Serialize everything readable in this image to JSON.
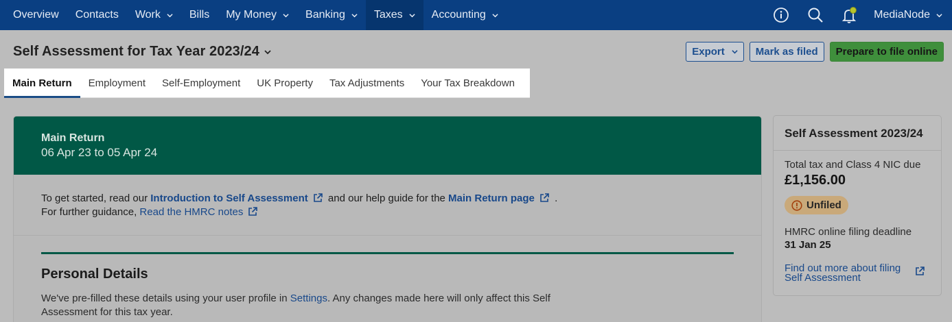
{
  "nav": {
    "items": [
      {
        "label": "Overview",
        "dropdown": false
      },
      {
        "label": "Contacts",
        "dropdown": false
      },
      {
        "label": "Work",
        "dropdown": true
      },
      {
        "label": "Bills",
        "dropdown": false
      },
      {
        "label": "My Money",
        "dropdown": true
      },
      {
        "label": "Banking",
        "dropdown": true
      },
      {
        "label": "Taxes",
        "dropdown": true,
        "active": true
      },
      {
        "label": "Accounting",
        "dropdown": true
      }
    ],
    "user": "MediaNode",
    "icons": [
      "info-icon",
      "search-icon",
      "bell-icon"
    ]
  },
  "header": {
    "title": "Self Assessment for Tax Year 2023/24",
    "export_label": "Export",
    "mark_filed_label": "Mark as filed",
    "prepare_label": "Prepare to file online"
  },
  "tabs": [
    {
      "label": "Main Return",
      "active": true
    },
    {
      "label": "Employment"
    },
    {
      "label": "Self-Employment"
    },
    {
      "label": "UK Property"
    },
    {
      "label": "Tax Adjustments"
    },
    {
      "label": "Your Tax Breakdown"
    }
  ],
  "main": {
    "banner_title": "Main Return",
    "banner_dates": "06 Apr 23 to 05 Apr 24",
    "guidance": {
      "text1": "To get started, read our ",
      "link1": "Introduction to Self Assessment",
      "text2": " and our help guide for the ",
      "link2": "Main Return page",
      "text3": " .",
      "text4": "For further guidance, ",
      "link3": "Read the HMRC notes"
    },
    "section_title": "Personal Details",
    "section_desc_1": "We've pre-filled these details using your user profile in ",
    "section_desc_link": "Settings",
    "section_desc_2": ". Any changes made here will only affect this Self Assessment for this tax year."
  },
  "side": {
    "title": "Self Assessment 2023/24",
    "tax_label": "Total tax and Class 4 NIC due",
    "tax_amount": "£1,156.00",
    "status": "Unfiled",
    "deadline_label": "HMRC online filing deadline",
    "deadline": "31 Jan 25",
    "link": "Find out more about filing Self Assessment"
  },
  "colors": {
    "nav_bg": "#0a3f82",
    "banner": "#015846",
    "primary_button": "#3f8f3c",
    "link": "#18488a",
    "badge": "#c9a97a"
  }
}
